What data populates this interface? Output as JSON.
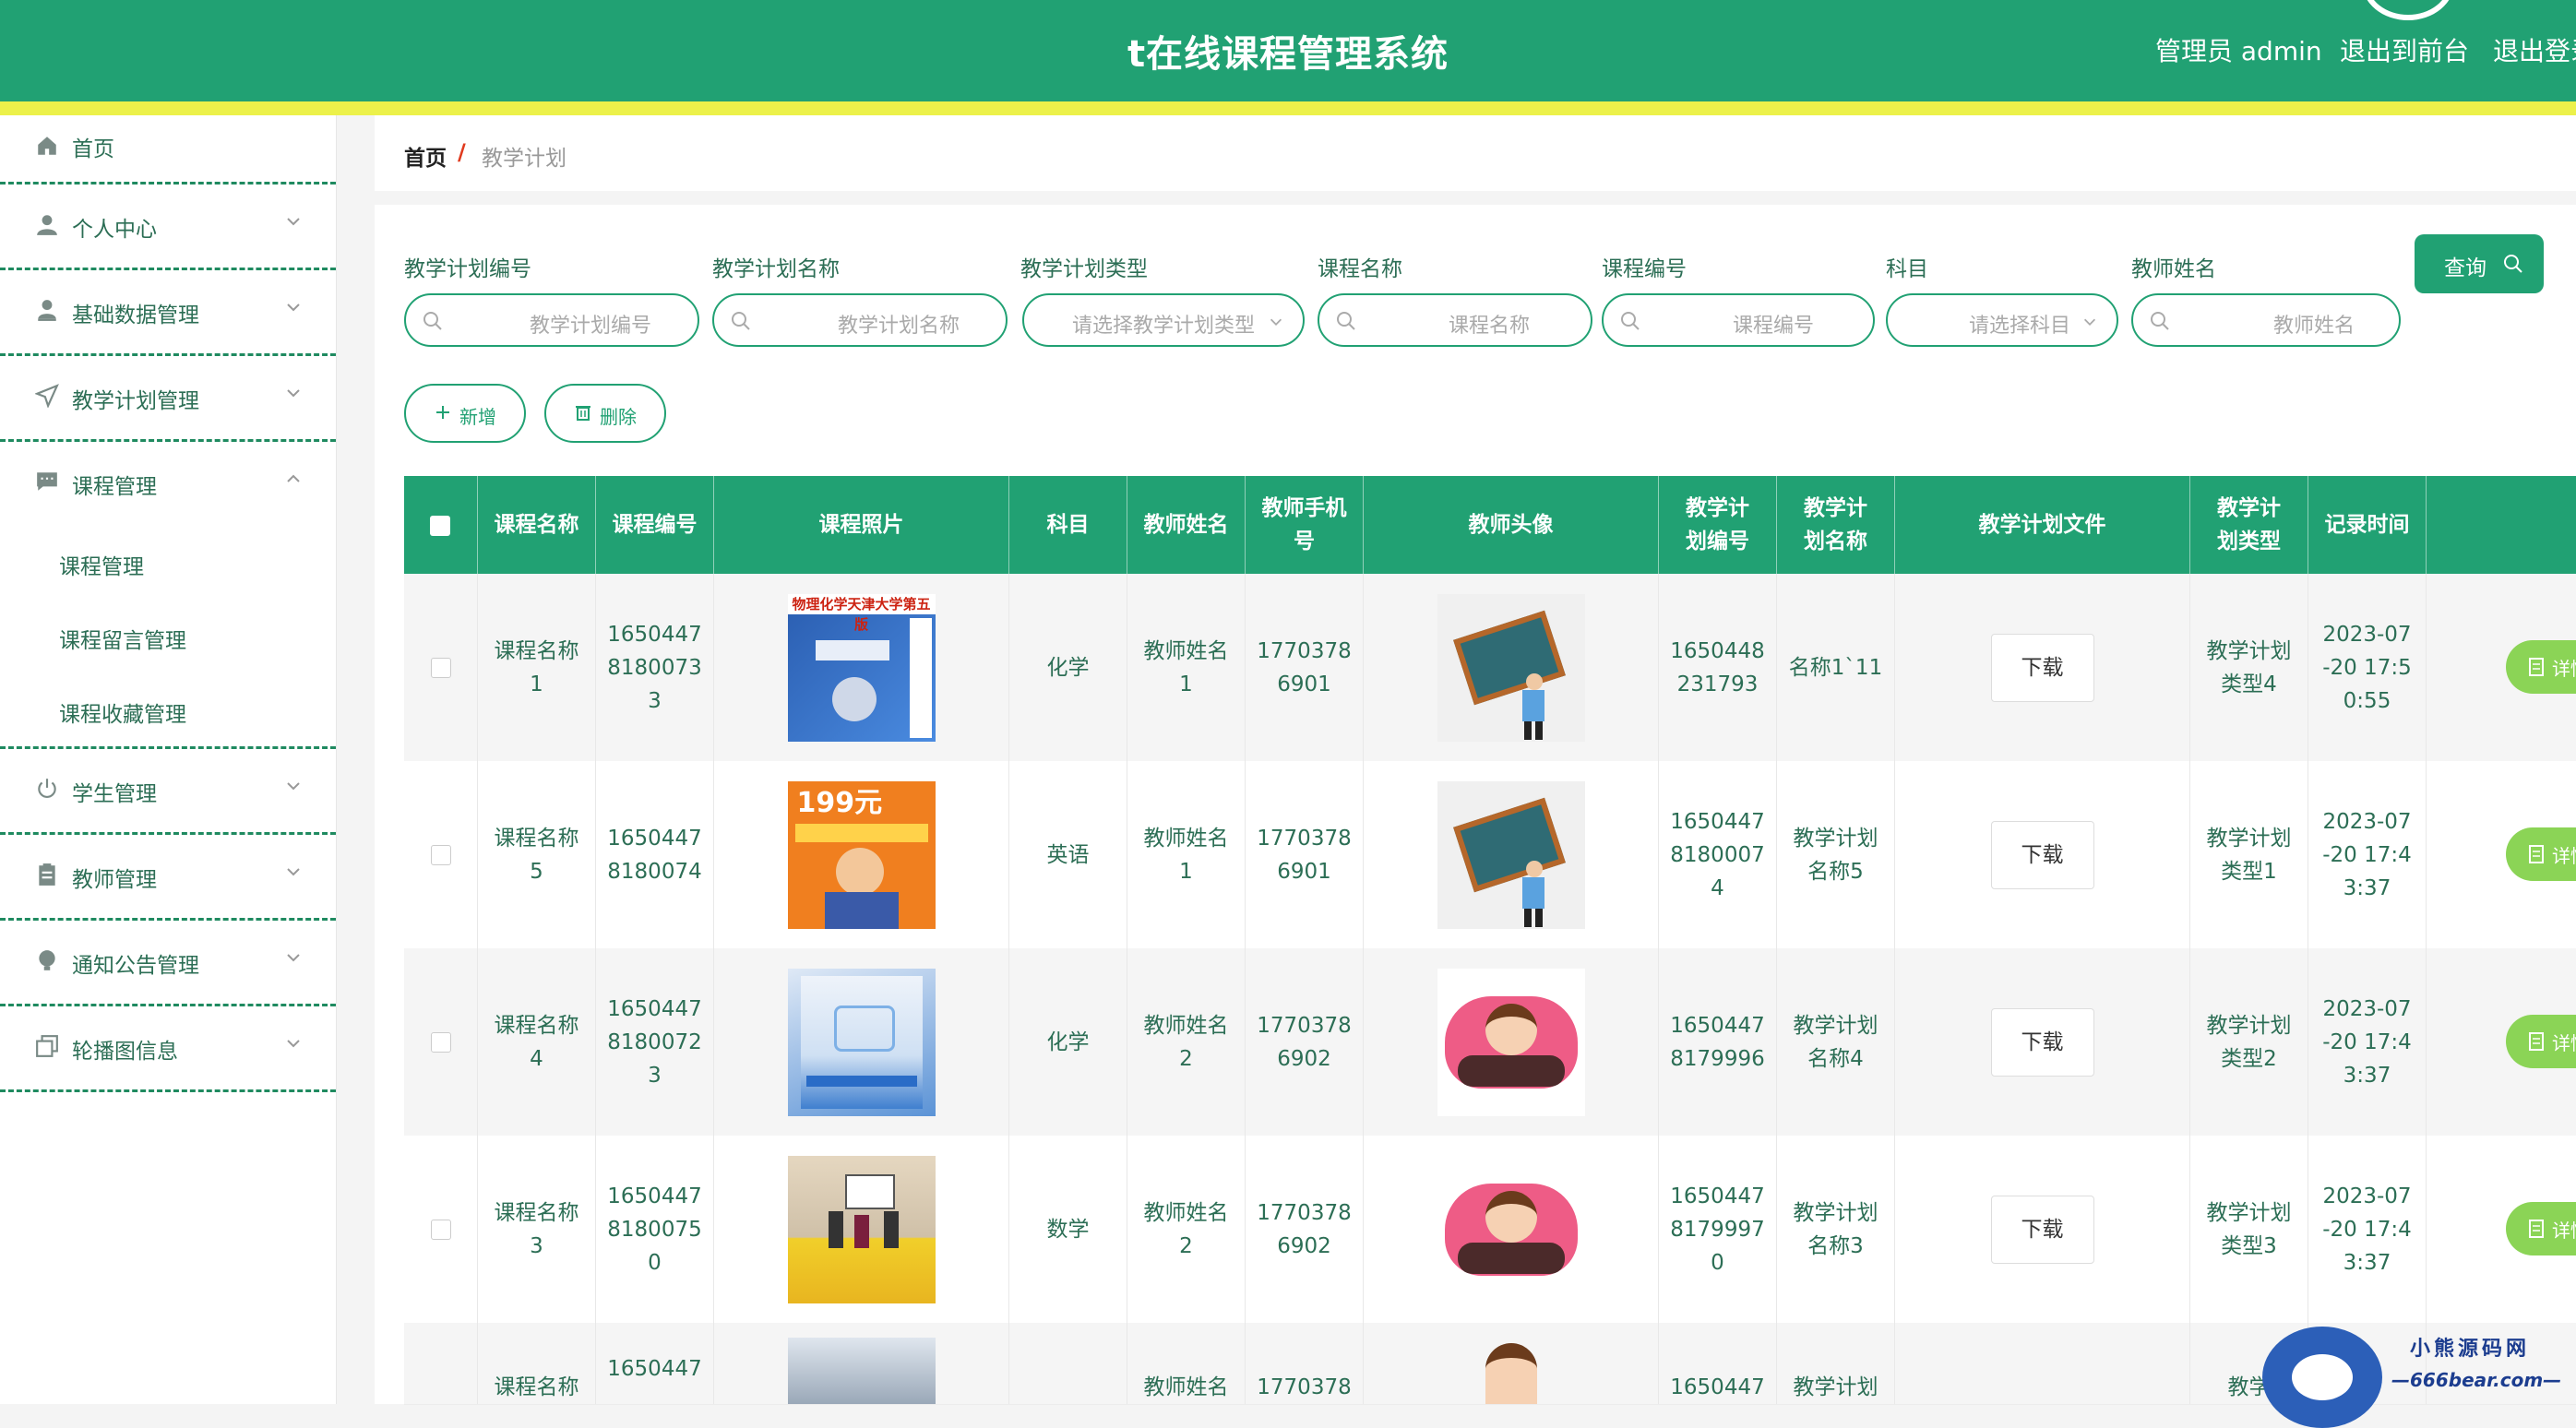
{
  "header": {
    "title": "t在线课程管理系统",
    "admin_label": "管理员 admin",
    "to_front": "退出到前台",
    "logout": "退出登录"
  },
  "sidebar": {
    "items": [
      {
        "label": "首页",
        "icon": "home-icon"
      },
      {
        "label": "个人中心",
        "icon": "user-icon"
      },
      {
        "label": "基础数据管理",
        "icon": "user-icon"
      },
      {
        "label": "教学计划管理",
        "icon": "send-icon"
      },
      {
        "label": "课程管理",
        "icon": "chat-icon",
        "expanded": true
      },
      {
        "label": "学生管理",
        "icon": "power-icon"
      },
      {
        "label": "教师管理",
        "icon": "clipboard-icon"
      },
      {
        "label": "通知公告管理",
        "icon": "bulb-icon"
      },
      {
        "label": "轮播图信息",
        "icon": "copy-icon"
      }
    ],
    "subitems": [
      "课程管理",
      "课程留言管理",
      "课程收藏管理"
    ]
  },
  "breadcrumb": {
    "home": "首页",
    "separator": "/",
    "current": "教学计划"
  },
  "filters": {
    "fields": [
      {
        "label": "教学计划编号",
        "placeholder": "教学计划编号",
        "type": "input"
      },
      {
        "label": "教学计划名称",
        "placeholder": "教学计划名称",
        "type": "input"
      },
      {
        "label": "教学计划类型",
        "placeholder": "请选择教学计划类型",
        "type": "select"
      },
      {
        "label": "课程名称",
        "placeholder": "课程名称",
        "type": "input"
      },
      {
        "label": "课程编号",
        "placeholder": "课程编号",
        "type": "input"
      },
      {
        "label": "科目",
        "placeholder": "请选择科目",
        "type": "select"
      },
      {
        "label": "教师姓名",
        "placeholder": "教师姓名",
        "type": "input"
      }
    ],
    "query_label": "查询"
  },
  "actions": {
    "add": "新增",
    "delete": "删除"
  },
  "table": {
    "headers": [
      "课程名称",
      "课程编号",
      "课程照片",
      "科目",
      "教师姓名",
      "教师手机号",
      "教师头像",
      "教学计划编号",
      "教学计划名称",
      "教学计划文件",
      "教学计划类型",
      "记录时间"
    ],
    "download_label": "下载",
    "detail_label": "详情",
    "rows": [
      {
        "course_name": "课程名称1",
        "course_no": "16504478180073 3",
        "photo": "book-blue",
        "photo_text": "物理化学天津大学第五版",
        "subject": "化学",
        "teacher": "教师姓名1",
        "phone": "17703786901",
        "avatar": "board",
        "plan_no": "1650448231793",
        "plan_name": "名称1`11",
        "plan_type": "教学计划类型4",
        "time": "2023-07-20 17:50:55"
      },
      {
        "course_name": "课程名称5",
        "course_no": "16504478180074",
        "photo": "book-orange",
        "photo_text": "199元",
        "subject": "英语",
        "teacher": "教师姓名1",
        "phone": "17703786901",
        "avatar": "board",
        "plan_no": "16504478180007 4",
        "plan_name": "教学计划名称5",
        "plan_type": "教学计划类型1",
        "time": "2023-07-20 17:43:37"
      },
      {
        "course_name": "课程名称4",
        "course_no": "16504478180072 3",
        "photo": "book-light",
        "photo_text": "",
        "subject": "化学",
        "teacher": "教师姓名2",
        "phone": "17703786902",
        "avatar": "heart",
        "plan_no": "16504478179996",
        "plan_name": "教学计划名称4",
        "plan_type": "教学计划类型2",
        "time": "2023-07-20 17:43:37"
      },
      {
        "course_name": "课程名称3",
        "course_no": "16504478180075 0",
        "photo": "classroom",
        "photo_text": "",
        "subject": "数学",
        "teacher": "教师姓名2",
        "phone": "17703786902",
        "avatar": "heart",
        "plan_no": "16504478179997 0",
        "plan_name": "教学计划名称3",
        "plan_type": "教学计划类型3",
        "time": "2023-07-20 17:43:37"
      },
      {
        "course_name": "课程名称",
        "course_no": "1650447",
        "photo": "classroom2",
        "photo_text": "",
        "subject": "",
        "teacher": "教师姓名",
        "phone": "1770378",
        "avatar": "girl",
        "plan_no": "1650447",
        "plan_name": "教学计划",
        "plan_type": "教学",
        "time": ""
      }
    ]
  },
  "watermark": {
    "line1": "小熊源码网",
    "line2": "—666bear.com—"
  },
  "colors": {
    "primary": "#21a173",
    "accent": "#ecf14a",
    "detail": "#8bd456",
    "danger": "#e03a1e"
  }
}
